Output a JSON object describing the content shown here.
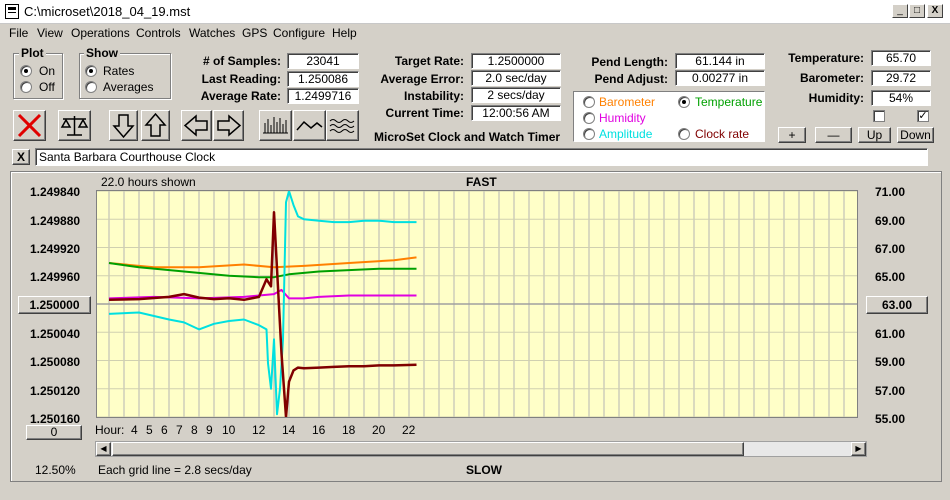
{
  "window": {
    "title": "C:\\microset\\2018_04_19.mst",
    "minimize": "_",
    "maximize": "□",
    "close": "X"
  },
  "menu": [
    "File",
    "View",
    "Operations",
    "Controls",
    "Watches",
    "GPS",
    "Configure",
    "Help"
  ],
  "plot_group": {
    "title": "Plot",
    "options": [
      "On",
      "Off"
    ],
    "selected": "On"
  },
  "show_group": {
    "title": "Show",
    "options": [
      "Rates",
      "Averages"
    ],
    "selected": "Rates"
  },
  "stats": {
    "samples_label": "# of Samples:",
    "samples": "23041",
    "last_label": "Last Reading:",
    "last": "1.250086",
    "avg_label": "Average Rate:",
    "avg": "1.2499716",
    "target_label": "Target Rate:",
    "target": "1.2500000",
    "avgerr_label": "Average Error:",
    "avgerr": "2.0 sec/day",
    "instab_label": "Instability:",
    "instab": "2 secs/day",
    "time_label": "Current Time:",
    "time": "12:00:56 AM",
    "pendlen_label": "Pend Length:",
    "pendlen": "61.144 in",
    "pendadj_label": "Pend Adjust:",
    "pendadj": "0.00277 in",
    "temp_label": "Temperature:",
    "temp": "65.70",
    "baro_label": "Barometer:",
    "baro": "29.72",
    "hum_label": "Humidity:",
    "hum": "54%"
  },
  "app_subtitle": "MicroSet Clock and Watch Timer",
  "sensor_options": [
    {
      "label": "Barometer",
      "color": "#ff8000",
      "selected": false
    },
    {
      "label": "Temperature",
      "color": "#00a000",
      "selected": true
    },
    {
      "label": "Humidity",
      "color": "#e000e0",
      "selected": false
    },
    {
      "label": "Clock rate",
      "color": "#800000",
      "selected": false
    },
    {
      "label": "Amplitude",
      "color": "#00e0e0",
      "selected": false
    }
  ],
  "adjust_buttons": [
    "+",
    "—",
    "Up",
    "Down"
  ],
  "clock_name": "Santa Barbara Courthouse Clock",
  "close_clock_label": "X",
  "graph": {
    "hours_shown": "22.0 hours shown",
    "fast_label": "FAST",
    "slow_label": "SLOW",
    "center_button": "1.250000",
    "right_button": "63.00",
    "zero_button": "0",
    "zoom": "12.50%",
    "grid_note": "Each grid line = 2.8 secs/day",
    "hour_label": "Hour:",
    "x_ticks": [
      "4",
      "5",
      "6",
      "7",
      "8",
      "9",
      "10",
      "12",
      "14",
      "16",
      "18",
      "20",
      "22"
    ],
    "left_ticks": [
      "1.249840",
      "1.249880",
      "1.249920",
      "1.249960",
      "1.250040",
      "1.250080",
      "1.250120",
      "1.250160"
    ],
    "right_ticks": [
      "71.00",
      "69.00",
      "67.00",
      "65.00",
      "61.00",
      "59.00",
      "57.00",
      "55.00"
    ]
  },
  "chart_data": {
    "type": "line",
    "y_left_range": [
      1.24984,
      1.25016
    ],
    "y_left_direction": "inverted",
    "y_right_range": [
      55,
      71
    ],
    "grid": true,
    "x_unit": "hour",
    "series": [
      {
        "name": "Clock rate",
        "color": "#800000",
        "axis": "left",
        "x": [
          3,
          5,
          7,
          8,
          9,
          10,
          11,
          12,
          13,
          13.5,
          13.8,
          14,
          14.2,
          14.5,
          14.8,
          15,
          15.3,
          15.6,
          16,
          17,
          18,
          19,
          20,
          21,
          22,
          23.5
        ],
        "y": [
          1.249994,
          1.249993,
          1.24999,
          1.249986,
          1.249991,
          1.249993,
          1.249992,
          1.249994,
          1.24999,
          1.249965,
          1.249975,
          1.24987,
          1.24995,
          1.25007,
          1.25016,
          1.25011,
          1.250094,
          1.25009,
          1.250091,
          1.25009,
          1.250089,
          1.250088,
          1.250088,
          1.250087,
          1.250087,
          1.250086
        ]
      },
      {
        "name": "Barometer",
        "color": "#ff8000",
        "axis": "right",
        "x": [
          3,
          6,
          9,
          12,
          14,
          16,
          19,
          22,
          23.5
        ],
        "y": [
          65.9,
          65.6,
          65.6,
          65.8,
          65.6,
          65.7,
          65.9,
          66.1,
          66.3
        ]
      },
      {
        "name": "Temperature",
        "color": "#00a000",
        "axis": "right",
        "x": [
          3,
          5,
          8,
          11,
          13,
          14,
          15,
          17,
          19,
          21,
          23.5
        ],
        "y": [
          65.9,
          65.6,
          65.3,
          65.0,
          64.9,
          64.9,
          65.1,
          65.3,
          65.4,
          65.5,
          65.5
        ]
      },
      {
        "name": "Humidity",
        "color": "#e000e0",
        "axis": "right",
        "x": [
          3,
          6,
          9,
          12,
          13,
          14,
          14.5,
          15,
          16,
          17,
          19,
          21,
          23.5
        ],
        "y": [
          63.4,
          63.5,
          63.4,
          63.5,
          63.6,
          63.7,
          64.0,
          63.4,
          63.4,
          63.5,
          63.6,
          63.6,
          63.6
        ]
      },
      {
        "name": "Amplitude",
        "color": "#00e0e0",
        "axis": "right",
        "x": [
          3,
          5,
          7,
          8,
          9,
          10,
          11,
          12,
          13,
          13.5,
          13.6,
          13.8,
          14,
          14.2,
          14.4,
          14.6,
          14.8,
          15,
          15.3,
          15.6,
          16,
          17,
          18,
          19,
          20,
          21,
          22,
          23.5
        ],
        "y": [
          62.3,
          62.4,
          61.9,
          61.7,
          61.2,
          61.6,
          61.8,
          61.9,
          61.5,
          61.2,
          58.8,
          57.0,
          60.5,
          55.2,
          57.0,
          60.5,
          70.2,
          71.0,
          70.0,
          69.2,
          69.0,
          68.9,
          68.8,
          68.8,
          68.9,
          68.9,
          68.8,
          68.8
        ]
      }
    ]
  }
}
